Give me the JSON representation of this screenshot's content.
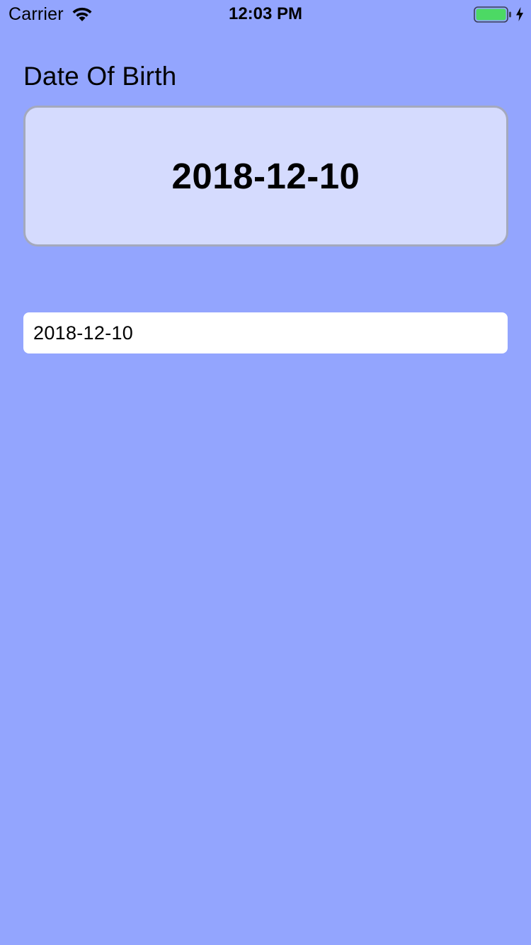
{
  "status_bar": {
    "carrier": "Carrier",
    "time": "12:03 PM",
    "icons": [
      "wifi-icon",
      "battery-icon",
      "charging-icon"
    ],
    "battery_level": 1.0,
    "battery_color": "#4cd964"
  },
  "form": {
    "label": "Date Of Birth",
    "selected_date": "2018-12-10",
    "field_value": "2018-12-10"
  },
  "colors": {
    "background": "#93a5fe",
    "date_card": "#d5dbfe",
    "date_card_border": "#a4a9bd",
    "field": "#ffffff"
  }
}
